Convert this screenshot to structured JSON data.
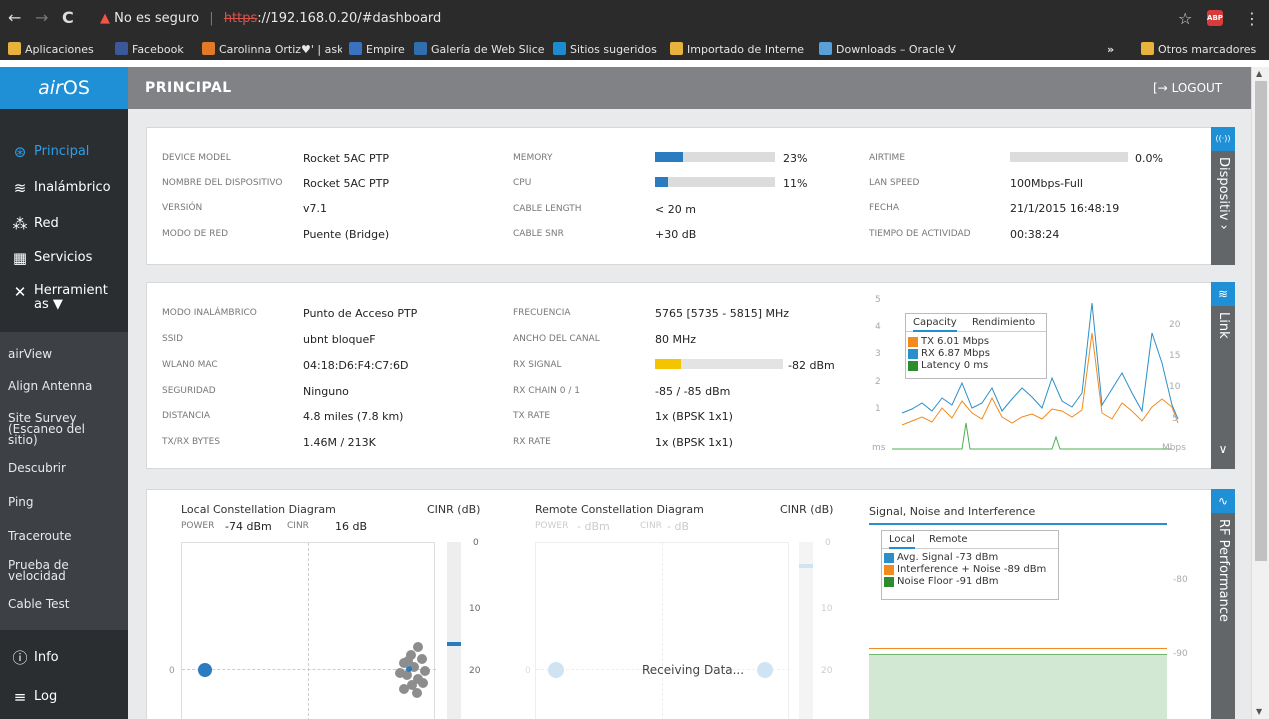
{
  "browser": {
    "back_glyph": "←",
    "forward_glyph": "→",
    "reload_glyph": "C",
    "security_icon": "▲",
    "security_text": "No es seguro",
    "separator": "|",
    "url_scheme": "https",
    "url_rest": "://192.168.0.20/#dashboard",
    "star_glyph": "☆",
    "abp_label": "ABP",
    "menu_glyph": "⋮",
    "bookmarks": [
      {
        "label": "Aplicaciones",
        "color": "#e8b33c"
      },
      {
        "label": "Facebook",
        "color": "#3b5998"
      },
      {
        "label": "Carolinna Ortiz♥' | ask",
        "color": "#e07a2a"
      },
      {
        "label": "Empire",
        "color": "#3a72c2"
      },
      {
        "label": "Galería de Web Slice",
        "color": "#2f6fb0"
      },
      {
        "label": "Sitios sugeridos",
        "color": "#1d8bd1"
      },
      {
        "label": "Importado de Interne",
        "color": "#e8b33c"
      },
      {
        "label": "Downloads – Oracle V",
        "color": "#5aa0d8"
      }
    ],
    "bookmarks_more": "»",
    "other_bookmarks": "Otros marcadores"
  },
  "app": {
    "logo_air": "air",
    "logo_os": "OS",
    "page_title": "PRINCIPAL",
    "logout_icon": "[→",
    "logout_label": "LOGOUT",
    "nav": [
      {
        "label": "Principal",
        "icon": "⊛"
      },
      {
        "label": "Inalámbrico",
        "icon": "≋"
      },
      {
        "label": "Red",
        "icon": "⁂"
      },
      {
        "label": "Servicios",
        "icon": "▦"
      },
      {
        "label": "Herramient",
        "label2": "as ▼",
        "icon": "✕"
      }
    ],
    "tools": [
      [
        "airView"
      ],
      [
        "Align Antenna"
      ],
      [
        "Site Survey",
        "(Escaneo del",
        "sitio)"
      ],
      [
        "Descubrir"
      ],
      [
        "Ping"
      ],
      [
        "Traceroute"
      ],
      [
        "Prueba de",
        "velocidad"
      ],
      [
        "Cable Test"
      ]
    ],
    "footer_nav": [
      {
        "label": "Info",
        "icon": "ⓘ"
      },
      {
        "label": "Log",
        "icon": "≡"
      }
    ]
  },
  "device": {
    "tab_label": "Dispositiv",
    "tab_chevron": "›",
    "tab_icon": "((·))",
    "col1": [
      {
        "label": "DEVICE MODEL",
        "value": "Rocket 5AC PTP"
      },
      {
        "label": "NOMBRE DEL DISPOSITIVO",
        "value": "Rocket 5AC PTP"
      },
      {
        "label": "VERSIÓN",
        "value": "v7.1"
      },
      {
        "label": "MODO DE RED",
        "value": "Puente (Bridge)"
      }
    ],
    "memory": {
      "label": "MEMORY",
      "value": "23%",
      "fraction": 0.23
    },
    "cpu": {
      "label": "CPU",
      "value": "11%",
      "fraction": 0.11
    },
    "cable_length": {
      "label": "CABLE LENGTH",
      "value": "< 20 m"
    },
    "cable_snr": {
      "label": "CABLE SNR",
      "value": "+30 dB"
    },
    "airtime": {
      "label": "AIRTIME",
      "value": "0.0%",
      "fraction": 0.0
    },
    "col4": [
      {
        "label": "LAN SPEED",
        "value": "100Mbps-Full"
      },
      {
        "label": "FECHA",
        "value": "21/1/2015 16:48:19"
      },
      {
        "label": "TIEMPO DE ACTIVIDAD",
        "value": "00:38:24"
      }
    ]
  },
  "link": {
    "tab_label": "Link",
    "tab_icon": "≋",
    "tab_chevron": "∨",
    "col1": [
      {
        "label": "MODO INALÁMBRICO",
        "value": "Punto de Acceso PTP"
      },
      {
        "label": "SSID",
        "value": "ubnt bloqueF"
      },
      {
        "label": "WLAN0 MAC",
        "value": "04:18:D6:F4:C7:6D"
      },
      {
        "label": "SEGURIDAD",
        "value": "Ninguno"
      },
      {
        "label": "DISTANCIA",
        "value": "4.8 miles (7.8 km)"
      },
      {
        "label": "TX/RX BYTES",
        "value": "1.46M / 213K"
      }
    ],
    "col2": [
      {
        "label": "FRECUENCIA",
        "value": "5765 [5735 - 5815] MHz"
      },
      {
        "label": "ANCHO DEL CANAL",
        "value": "80 MHz"
      },
      {
        "label": "RX SIGNAL",
        "value": "-82 dBm"
      },
      {
        "label": "RX CHAIN 0 / 1",
        "value": "-85 / -85 dBm"
      },
      {
        "label": "TX RATE",
        "value": "1x (BPSK 1x1)"
      },
      {
        "label": "RX RATE",
        "value": "1x (BPSK 1x1)"
      }
    ],
    "rx_signal_fraction": 0.2,
    "chart": {
      "tab_active": "Capacity",
      "tab_other": "Rendimiento",
      "left_ticks": [
        "5",
        "4",
        "3",
        "2",
        "1"
      ],
      "right_ticks": [
        "20",
        "15",
        "10",
        "5"
      ],
      "left_unit": "ms",
      "right_unit": "Mbps",
      "legend": [
        {
          "label": "TX 6.01 Mbps",
          "color": "#f28a1e"
        },
        {
          "label": "RX 6.87 Mbps",
          "color": "#2b8fc9"
        },
        {
          "label": "Latency 0 ms",
          "color": "#2e8b2e"
        }
      ]
    }
  },
  "rf": {
    "tab_label": "RF Performance",
    "tab_icon": "∿",
    "local": {
      "title": "Local Constellation Diagram",
      "cinr_title": "CINR (dB)",
      "power_label": "POWER",
      "power_value": "-74 dBm",
      "cinr_label": "CINR",
      "cinr_value": "16 dB",
      "axis_zero": "0",
      "scale": [
        "0",
        "10",
        "20"
      ]
    },
    "remote": {
      "title": "Remote Constellation Diagram",
      "cinr_title": "CINR (dB)",
      "power_label": "POWER",
      "power_value": "- dBm",
      "cinr_label": "CINR",
      "cinr_value": "- dB",
      "axis_zero": "0",
      "scale": [
        "0",
        "10",
        "20"
      ],
      "receiving": "Receiving Data..."
    },
    "sni": {
      "title": "Signal, Noise and Interference",
      "tab_active": "Local",
      "tab_other": "Remote",
      "legend": [
        {
          "label": "Avg. Signal -73 dBm",
          "color": "#2b8fc9"
        },
        {
          "label": "Interference + Noise -89 dBm",
          "color": "#f28a1e"
        },
        {
          "label": "Noise Floor -91 dBm",
          "color": "#2e8b2e"
        }
      ],
      "right_ticks": [
        "-80",
        "-90"
      ]
    }
  }
}
